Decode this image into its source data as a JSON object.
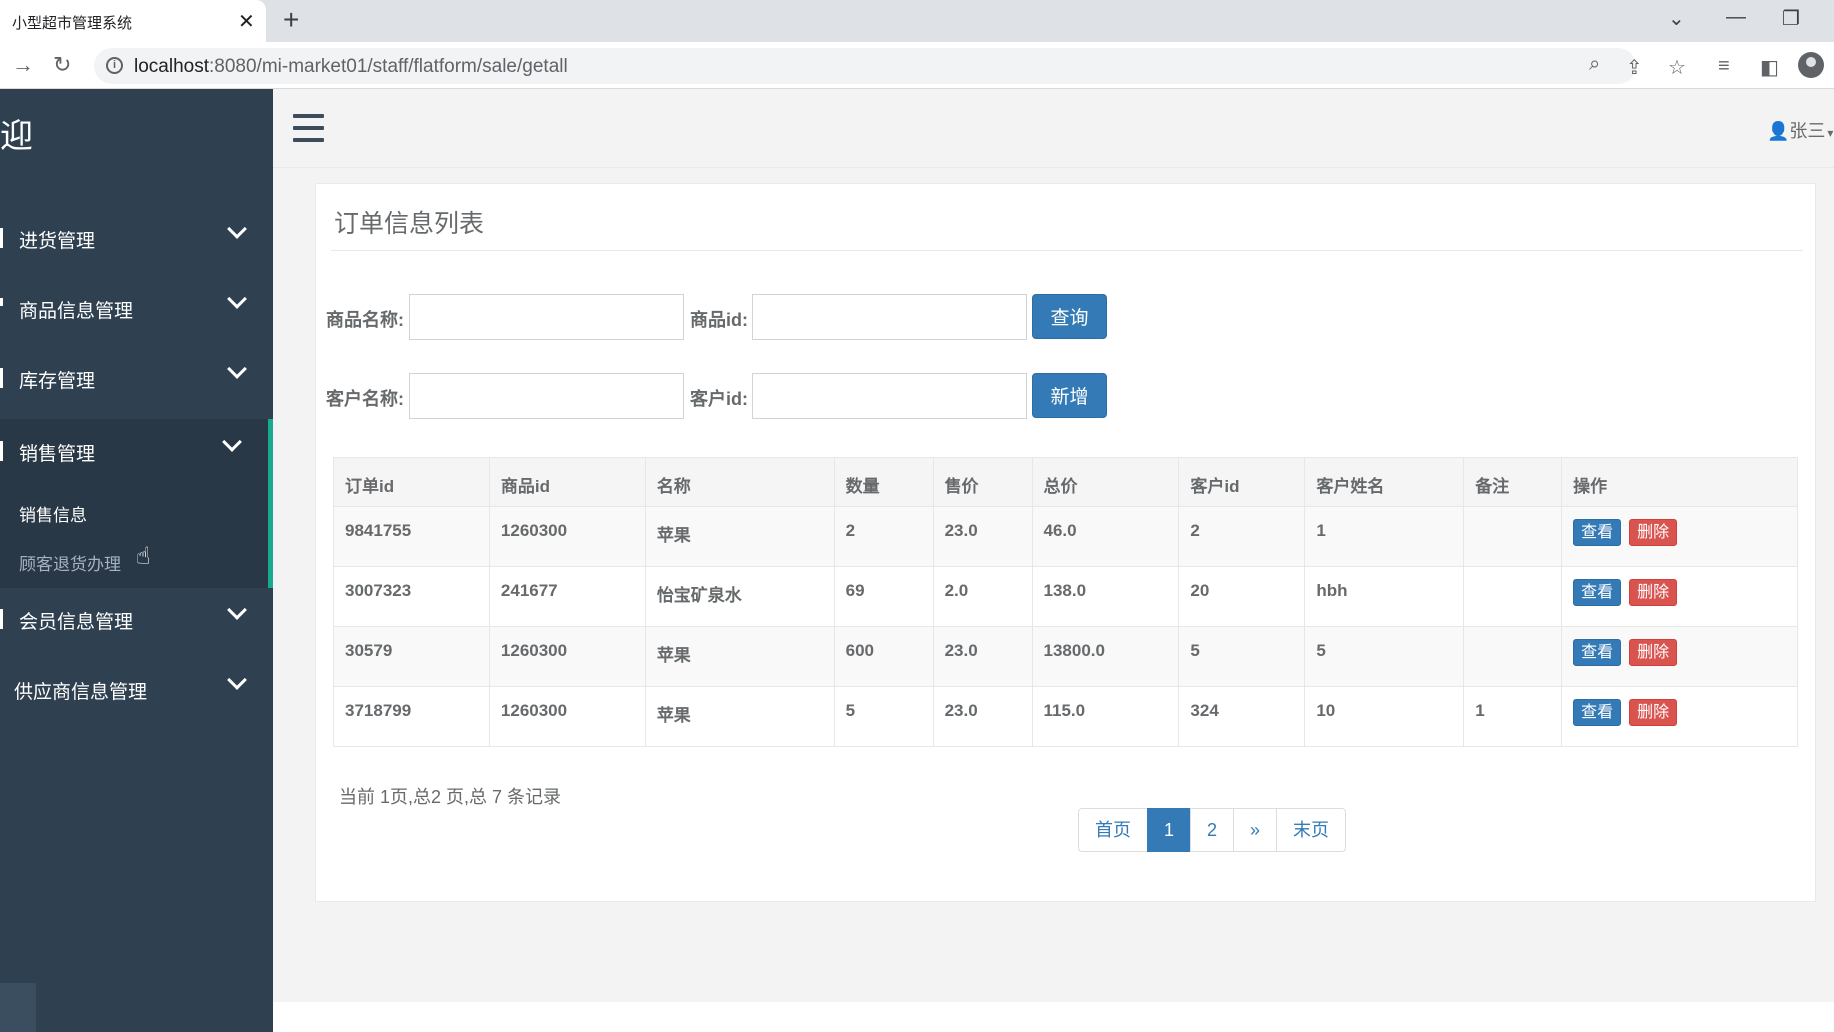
{
  "browser": {
    "tab_title": "小型超市管理系统",
    "tab_close": "✕",
    "new_tab": "+",
    "url_host": "localhost",
    "url_path": ":8080/mi-market01/staff/flatform/sale/getall",
    "icons": [
      "back-icon",
      "reload-icon",
      "info-icon",
      "zoom-icon",
      "share-icon",
      "star-icon",
      "reading-list-icon",
      "side-panel-icon",
      "profile-icon"
    ]
  },
  "sidebar": {
    "brand": "迎",
    "menu": [
      {
        "label": "进货管理"
      },
      {
        "label": "商品信息管理"
      },
      {
        "label": "库存管理"
      },
      {
        "label": "销售管理"
      },
      {
        "label": "会员信息管理"
      },
      {
        "label": "供应商信息管理"
      }
    ],
    "submenu": [
      {
        "label": "销售信息"
      },
      {
        "label": "顾客退货办理"
      }
    ]
  },
  "header": {
    "user_name": "张三"
  },
  "panel": {
    "title": "订单信息列表"
  },
  "search": {
    "product_name_label": "商品名称:",
    "product_id_label": "商品id:",
    "customer_name_label": "客户名称:",
    "customer_id_label": "客户id:",
    "product_name_value": "",
    "product_id_value": "",
    "customer_name_value": "",
    "customer_id_value": "",
    "query_button": "查询",
    "add_button": "新增"
  },
  "table": {
    "columns": [
      "订单id",
      "商品id",
      "名称",
      "数量",
      "售价",
      "总价",
      "客户id",
      "客户姓名",
      "备注",
      "操作"
    ],
    "rows": [
      [
        "9841755",
        "1260300",
        "苹果",
        "2",
        "23.0",
        "46.0",
        "2",
        "1",
        ""
      ],
      [
        "3007323",
        "241677",
        "怡宝矿泉水",
        "69",
        "2.0",
        "138.0",
        "20",
        "hbh",
        ""
      ],
      [
        "30579",
        "1260300",
        "苹果",
        "600",
        "23.0",
        "13800.0",
        "5",
        "5",
        ""
      ],
      [
        "3718799",
        "1260300",
        "苹果",
        "5",
        "23.0",
        "115.0",
        "324",
        "10",
        "1"
      ]
    ],
    "view_label": "查看",
    "delete_label": "删除"
  },
  "pagination": {
    "info": "当前 1页,总2 页,总 7 条记录",
    "first": "首页",
    "pages": [
      "1",
      "2"
    ],
    "next": "»",
    "last": "末页",
    "current_page": "1"
  },
  "colors": {
    "sidebar": "#2f4050",
    "sidebar_active": "#293846",
    "accent": "#19aa8d",
    "primary": "#337ab7",
    "danger": "#d9534f"
  }
}
